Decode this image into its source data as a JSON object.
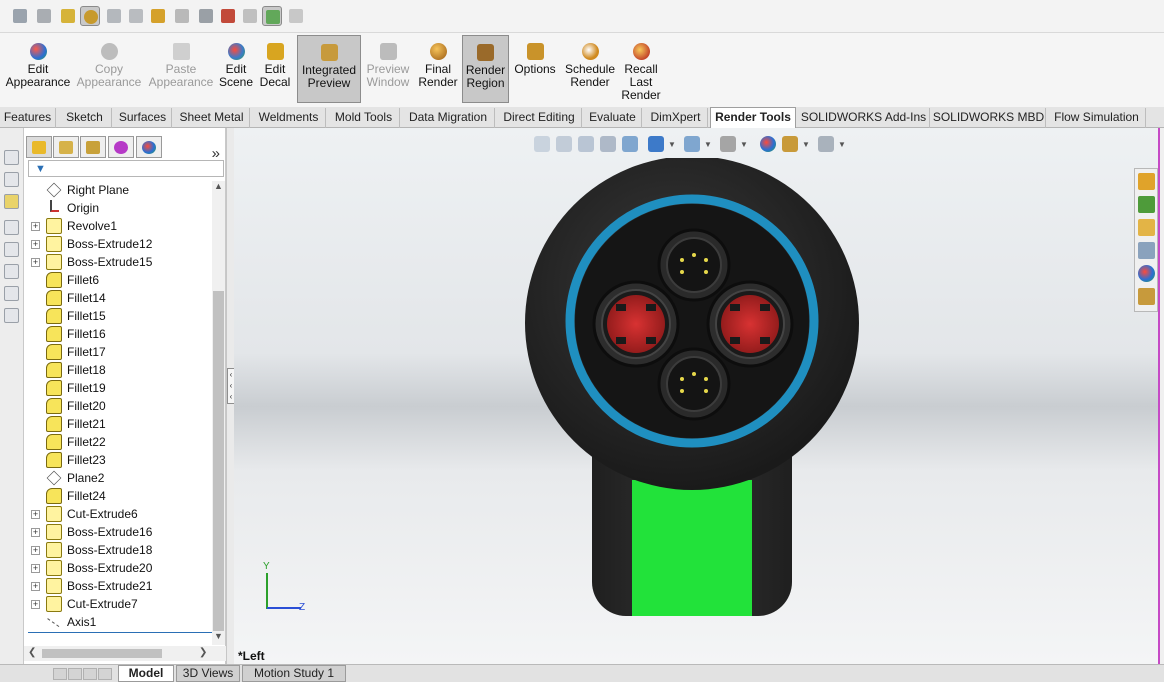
{
  "quick_access": {
    "icons": [
      "appearance-icon",
      "scene-icon",
      "decal-icon",
      "lighting-icon",
      "camera-icon",
      "render-icon",
      "layer-icon",
      "display-icon",
      "section-icon",
      "view-icon",
      "realview-icon",
      "shadow-icon",
      "ambient-icon"
    ]
  },
  "ribbon": {
    "commands": [
      {
        "label": "Edit\nAppearance",
        "icon": "appearance-icon",
        "color": "#d93a2b",
        "disabled": false,
        "pressed": false
      },
      {
        "label": "Copy\nAppearance",
        "icon": "copy-appearance-icon",
        "color": "#b8b8b8",
        "disabled": true,
        "pressed": false
      },
      {
        "label": "Paste\nAppearance",
        "icon": "paste-appearance-icon",
        "color": "#c8c8c8",
        "disabled": true,
        "pressed": false
      },
      {
        "label": "Edit\nScene",
        "icon": "scene-icon",
        "color": "#3d7ac9",
        "disabled": false,
        "pressed": false
      },
      {
        "label": "Edit\nDecal",
        "icon": "decal-icon",
        "color": "#d8a520",
        "disabled": false,
        "pressed": false
      },
      {
        "label": "Integrated\nPreview",
        "icon": "integrated-preview-icon",
        "color": "#c79a3c",
        "disabled": false,
        "pressed": true
      },
      {
        "label": "Preview\nWindow",
        "icon": "preview-window-icon",
        "color": "#b9b9b9",
        "disabled": true,
        "pressed": false
      },
      {
        "label": "Final\nRender",
        "icon": "final-render-icon",
        "color": "#c98a1f",
        "disabled": false,
        "pressed": false
      },
      {
        "label": "Render\nRegion",
        "icon": "render-region-icon",
        "color": "#9a6a2a",
        "disabled": false,
        "pressed": true
      },
      {
        "label": "Options",
        "icon": "options-icon",
        "color": "#c9932a",
        "disabled": false,
        "pressed": false
      },
      {
        "label": "Schedule\nRender",
        "icon": "schedule-render-icon",
        "color": "#d08a20",
        "disabled": false,
        "pressed": false
      },
      {
        "label": "Recall\nLast\nRender",
        "icon": "recall-last-render-icon",
        "color": "#c4462a",
        "disabled": false,
        "pressed": false
      }
    ]
  },
  "tabs": [
    {
      "label": "Features",
      "active": false
    },
    {
      "label": "Sketch",
      "active": false
    },
    {
      "label": "Surfaces",
      "active": false
    },
    {
      "label": "Sheet Metal",
      "active": false
    },
    {
      "label": "Weldments",
      "active": false
    },
    {
      "label": "Mold Tools",
      "active": false
    },
    {
      "label": "Data Migration",
      "active": false
    },
    {
      "label": "Direct Editing",
      "active": false
    },
    {
      "label": "Evaluate",
      "active": false
    },
    {
      "label": "DimXpert",
      "active": false
    },
    {
      "label": "Render Tools",
      "active": true
    },
    {
      "label": "SOLIDWORKS Add-Ins",
      "active": false
    },
    {
      "label": "SOLIDWORKS MBD",
      "active": false
    },
    {
      "label": "Flow Simulation",
      "active": false
    }
  ],
  "feature_manager": {
    "tabs": [
      "featuremanager-icon",
      "propertymanager-icon",
      "configurationmanager-icon",
      "dimxpert-manager-icon",
      "display-manager-icon"
    ],
    "more": "»",
    "filter_icon": "filter-icon",
    "tree": [
      {
        "label": "Right Plane",
        "type": "plane",
        "expandable": false
      },
      {
        "label": "Origin",
        "type": "origin",
        "expandable": false
      },
      {
        "label": "Revolve1",
        "type": "revolve",
        "expandable": true
      },
      {
        "label": "Boss-Extrude12",
        "type": "feature",
        "expandable": true
      },
      {
        "label": "Boss-Extrude15",
        "type": "feature",
        "expandable": true
      },
      {
        "label": "Fillet6",
        "type": "fillet",
        "expandable": false
      },
      {
        "label": "Fillet14",
        "type": "fillet",
        "expandable": false
      },
      {
        "label": "Fillet15",
        "type": "fillet",
        "expandable": false
      },
      {
        "label": "Fillet16",
        "type": "fillet",
        "expandable": false
      },
      {
        "label": "Fillet17",
        "type": "fillet",
        "expandable": false
      },
      {
        "label": "Fillet18",
        "type": "fillet",
        "expandable": false
      },
      {
        "label": "Fillet19",
        "type": "fillet",
        "expandable": false
      },
      {
        "label": "Fillet20",
        "type": "fillet",
        "expandable": false
      },
      {
        "label": "Fillet21",
        "type": "fillet",
        "expandable": false
      },
      {
        "label": "Fillet22",
        "type": "fillet",
        "expandable": false
      },
      {
        "label": "Fillet23",
        "type": "fillet",
        "expandable": false
      },
      {
        "label": "Plane2",
        "type": "plane",
        "expandable": false
      },
      {
        "label": "Fillet24",
        "type": "fillet",
        "expandable": false
      },
      {
        "label": "Cut-Extrude6",
        "type": "feature",
        "expandable": true
      },
      {
        "label": "Boss-Extrude16",
        "type": "feature",
        "expandable": true
      },
      {
        "label": "Boss-Extrude18",
        "type": "feature",
        "expandable": true
      },
      {
        "label": "Boss-Extrude20",
        "type": "feature",
        "expandable": true
      },
      {
        "label": "Boss-Extrude21",
        "type": "feature",
        "expandable": true
      },
      {
        "label": "Cut-Extrude7",
        "type": "feature",
        "expandable": true
      },
      {
        "label": "Axis1",
        "type": "axis",
        "expandable": false
      }
    ]
  },
  "viewport": {
    "view_name": "*Left",
    "triad": {
      "y": "Y",
      "z": "Z"
    },
    "heads_up_icons": [
      "zoom-to-fit-icon",
      "zoom-area-icon",
      "previous-view-icon",
      "section-view-icon",
      "dynamic-annotation-icon",
      "view-orientation-icon",
      "display-style-icon",
      "hide-show-icon",
      "edit-appearance-icon",
      "apply-scene-icon",
      "view-settings-icon"
    ],
    "task_pane_icons": [
      "solidworks-resources-icon",
      "design-library-icon",
      "file-explorer-icon",
      "view-palette-icon",
      "appearances-scenes-icon",
      "custom-properties-icon"
    ],
    "model_colors": {
      "body": "#2b2b2b",
      "ring": "#1f8fc0",
      "pin_red": "#c42828",
      "handle_green": "#22e23a"
    }
  },
  "bottom_tabs": [
    {
      "label": "Model",
      "active": true
    },
    {
      "label": "3D Views",
      "active": false
    },
    {
      "label": "Motion Study 1",
      "active": false
    }
  ]
}
